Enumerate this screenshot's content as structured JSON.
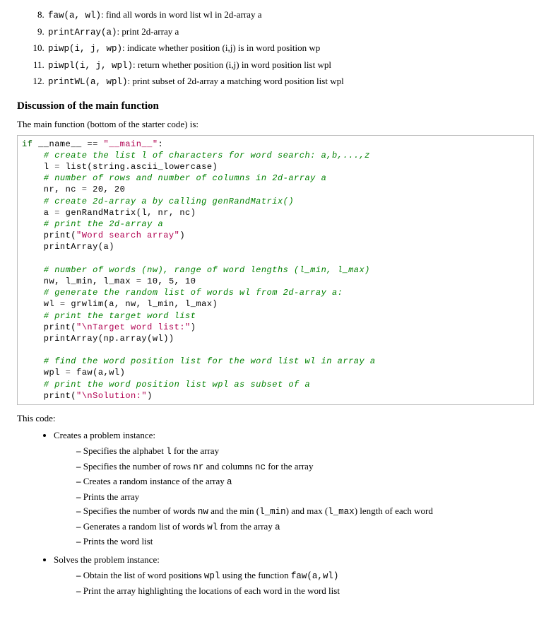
{
  "funcs": [
    {
      "num": "8",
      "sig": "faw(a, wl)",
      "desc": ": find all words in word list wl in 2d-array a"
    },
    {
      "num": "9",
      "sig": "printArray(a)",
      "desc": ": print 2d-array a"
    },
    {
      "num": "10",
      "sig": "piwp(i, j, wp)",
      "desc": ": indicate whether position (i,j) is in word position wp"
    },
    {
      "num": "11",
      "sig": "piwpl(i, j, wpl)",
      "desc": ": return whether position (i,j) in word position list wpl"
    },
    {
      "num": "12",
      "sig": "printWL(a, wpl)",
      "desc": ": print subset of 2d-array a matching word position list wpl"
    }
  ],
  "heading": "Discussion of the main function",
  "intro": "The main function (bottom of the starter code) is:",
  "code": {
    "l1a": "if",
    "l1b": " __name__ ",
    "l1c": "==",
    "l1d": " \"__main__\"",
    "l1e": ":",
    "l2": "    # create the list l of characters for word search: a,b,...,z",
    "l3a": "    l ",
    "l3b": "=",
    "l3c": " list(string.ascii_lowercase)",
    "l4": "    # number of rows and number of columns in 2d-array a",
    "l5a": "    nr, nc ",
    "l5b": "=",
    "l5c": " 20, 20",
    "l6": "    # create 2d-array a by calling genRandMatrix()",
    "l7a": "    a ",
    "l7b": "=",
    "l7c": " genRandMatrix(l, nr, nc)",
    "l8": "    # print the 2d-array a",
    "l9a": "    print(",
    "l9b": "\"Word search array\"",
    "l9c": ")",
    "l10": "    printArray(a)",
    "l11": " ",
    "l12": "    # number of words (nw), range of word lengths (l_min, l_max)",
    "l13a": "    nw, l_min, l_max ",
    "l13b": "=",
    "l13c": " 10, 5, 10",
    "l14": "    # generate the random list of words wl from 2d-array a:",
    "l15a": "    wl ",
    "l15b": "=",
    "l15c": " grwlim(a, nw, l_min, l_max)",
    "l16": "    # print the target word list",
    "l17a": "    print(",
    "l17b": "\"\\nTarget word list:\"",
    "l17c": ")",
    "l18": "    printArray(np.array(wl))",
    "l19": " ",
    "l20": "    # find the word position list for the word list wl in array a",
    "l21a": "    wpl ",
    "l21b": "=",
    "l21c": " faw(a,wl)",
    "l22": "    # print the word position list wpl as subset of a",
    "l23a": "    print(",
    "l23b": "\"\\nSolution:\"",
    "l23c": ")"
  },
  "post_code": "This code:",
  "bullets": {
    "top1": "Creates a problem instance:",
    "top2": "Solves the problem instance:",
    "c1a": "Specifies the alphabet ",
    "c1b": "l",
    "c1c": " for the array",
    "c2a": "Specifies the number of rows ",
    "c2b": "nr",
    "c2c": " and columns ",
    "c2d": "nc",
    "c2e": " for the array",
    "c3a": "Creates a random instance of the array ",
    "c3b": "a",
    "c4": "Prints the array",
    "c5a": "Specifies the number of words ",
    "c5b": "nw",
    "c5c": " and the min (",
    "c5d": "l_min",
    "c5e": ") and max (",
    "c5f": "l_max",
    "c5g": ") length of each word",
    "c6a": "Generates a random list of words ",
    "c6b": "wl",
    "c6c": " from the array ",
    "c6d": "a",
    "c7": "Prints the word list",
    "s1a": "Obtain the list of word positions ",
    "s1b": "wpl",
    "s1c": " using the function ",
    "s1d": "faw(a,wl)",
    "s2": "Print the array highlighting the locations of each word in the word list"
  }
}
